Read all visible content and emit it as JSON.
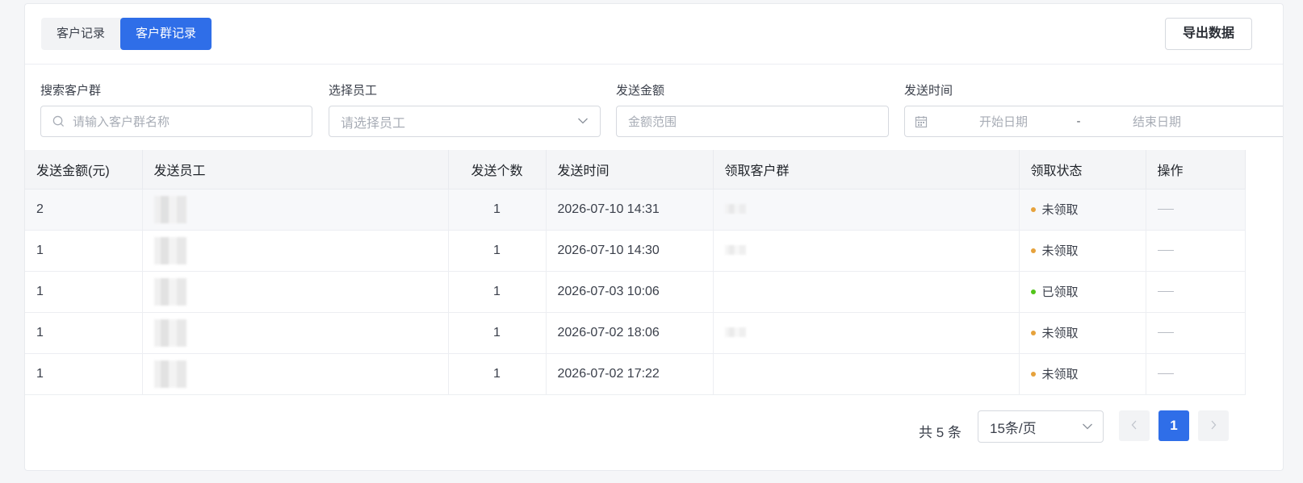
{
  "tabs": [
    {
      "label": "客户记录",
      "active": false
    },
    {
      "label": "客户群记录",
      "active": true
    }
  ],
  "export_label": "导出数据",
  "filters": {
    "group_search": {
      "label": "搜索客户群",
      "placeholder": "请输入客户群名称"
    },
    "employee": {
      "label": "选择员工",
      "placeholder": "请选择员工"
    },
    "amount": {
      "label": "发送金额",
      "placeholder": "金额范围"
    },
    "time": {
      "label": "发送时间",
      "start_placeholder": "开始日期",
      "separator": "-",
      "end_placeholder": "结束日期"
    }
  },
  "table": {
    "columns": [
      "发送金额(元)",
      "发送员工",
      "发送个数",
      "发送时间",
      "领取客户群",
      "领取状态",
      "操作"
    ],
    "rows": [
      {
        "amount": "2",
        "count": "1",
        "time": "2026-07-10 14:31",
        "status": "未领取",
        "status_color": "#e6a23c"
      },
      {
        "amount": "1",
        "count": "1",
        "time": "2026-07-10 14:30",
        "status": "未领取",
        "status_color": "#e6a23c"
      },
      {
        "amount": "1",
        "count": "1",
        "time": "2026-07-03 10:06",
        "status": "已领取",
        "status_color": "#52c41a"
      },
      {
        "amount": "1",
        "count": "1",
        "time": "2026-07-02 18:06",
        "status": "未领取",
        "status_color": "#e6a23c"
      },
      {
        "amount": "1",
        "count": "1",
        "time": "2026-07-02 17:22",
        "status": "未领取",
        "status_color": "#e6a23c"
      }
    ]
  },
  "pagination": {
    "total_text": "共 5 条",
    "page_size": "15条/页",
    "current_page": "1"
  },
  "colors": {
    "accent": "#2f6ee8",
    "pending": "#e6a23c",
    "received": "#52c41a"
  },
  "icons": [
    "search-icon",
    "chevron-down-icon",
    "calendar-icon",
    "chevron-left-icon",
    "chevron-right-icon"
  ]
}
